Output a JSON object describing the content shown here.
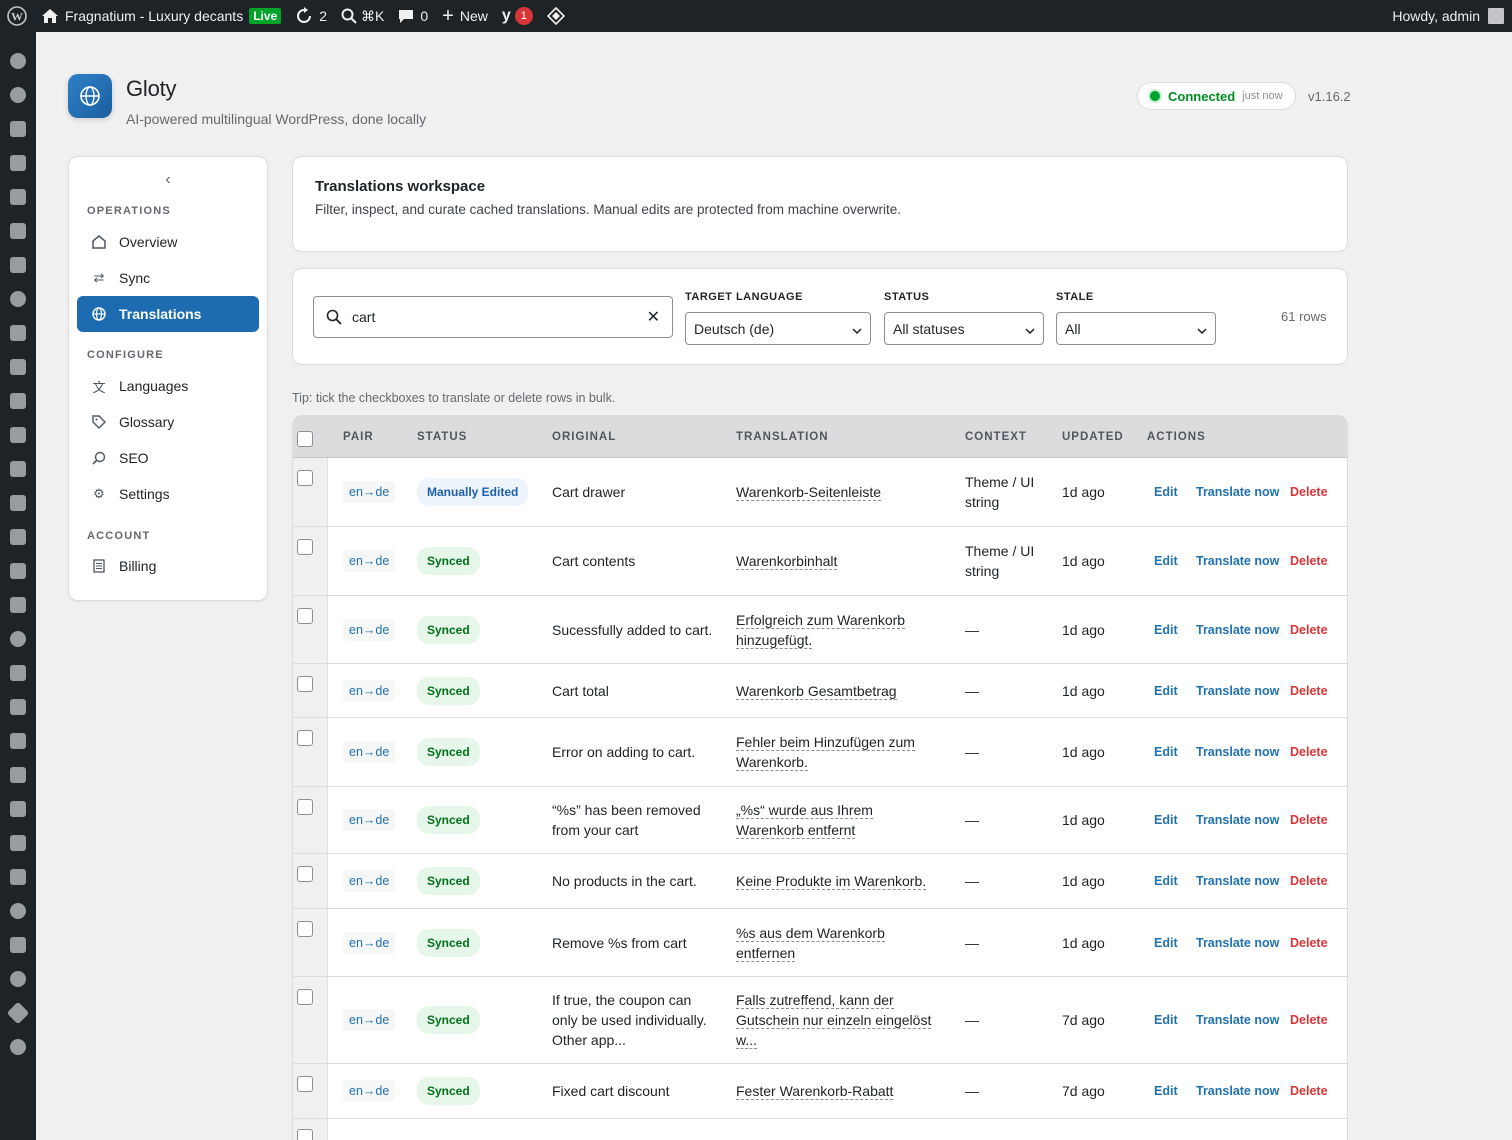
{
  "adminbar": {
    "site_name": "Fragnatium - Luxury decants",
    "live_label": "Live",
    "updates_count": "2",
    "search_shortcut": "⌘K",
    "comments_count": "0",
    "new_label": "New",
    "yoast_count": "1",
    "greeting": "Howdy, admin"
  },
  "header": {
    "title": "Gloty",
    "subtitle": "AI-powered multilingual WordPress, done locally",
    "connection_status": "Connected",
    "connection_time": "just now",
    "version": "v1.16.2"
  },
  "sidebar": {
    "sections": [
      {
        "heading": "OPERATIONS",
        "items": [
          {
            "label": "Overview",
            "icon": "home-icon"
          },
          {
            "label": "Sync",
            "icon": "sync-icon"
          },
          {
            "label": "Translations",
            "icon": "globe-icon",
            "active": true
          }
        ]
      },
      {
        "heading": "CONFIGURE",
        "items": [
          {
            "label": "Languages",
            "icon": "translate-icon"
          },
          {
            "label": "Glossary",
            "icon": "tag-icon"
          },
          {
            "label": "SEO",
            "icon": "search-icon"
          },
          {
            "label": "Settings",
            "icon": "gear-icon"
          }
        ]
      },
      {
        "heading": "ACCOUNT",
        "items": [
          {
            "label": "Billing",
            "icon": "receipt-icon"
          }
        ]
      }
    ]
  },
  "workspace": {
    "title": "Translations workspace",
    "description": "Filter, inspect, and curate cached translations. Manual edits are protected from machine overwrite."
  },
  "filters": {
    "search_value": "cart",
    "target_language_label": "TARGET LANGUAGE",
    "target_language_value": "Deutsch (de)",
    "status_label": "STATUS",
    "status_value": "All statuses",
    "stale_label": "STALE",
    "stale_value": "All",
    "row_count": "61 rows"
  },
  "tip": "Tip: tick the checkboxes to translate or delete rows in bulk.",
  "table": {
    "columns": [
      "PAIR",
      "STATUS",
      "ORIGINAL",
      "TRANSLATION",
      "CONTEXT",
      "UPDATED",
      "ACTIONS"
    ],
    "actions": {
      "edit": "Edit",
      "translate": "Translate now",
      "delete": "Delete"
    },
    "rows": [
      {
        "pair": "en→de",
        "status": "Manually Edited",
        "original": "Cart drawer",
        "translation": "Warenkorb-Seitenleiste",
        "context": "Theme / UI string",
        "updated": "1d ago"
      },
      {
        "pair": "en→de",
        "status": "Synced",
        "original": "Cart contents",
        "translation": "Warenkorbinhalt",
        "context": "Theme / UI string",
        "updated": "1d ago"
      },
      {
        "pair": "en→de",
        "status": "Synced",
        "original": "Sucessfully added to cart.",
        "translation": "Erfolgreich zum Warenkorb hinzugefügt.",
        "context": "—",
        "updated": "1d ago"
      },
      {
        "pair": "en→de",
        "status": "Synced",
        "original": "Cart total",
        "translation": "Warenkorb Gesamtbetrag",
        "context": "—",
        "updated": "1d ago"
      },
      {
        "pair": "en→de",
        "status": "Synced",
        "original": "Error on adding to cart.",
        "translation": "Fehler beim Hinzufügen zum Warenkorb.",
        "context": "—",
        "updated": "1d ago"
      },
      {
        "pair": "en→de",
        "status": "Synced",
        "original": "“%s” has been removed from your cart",
        "translation": "„%s“ wurde aus Ihrem Warenkorb entfernt",
        "context": "—",
        "updated": "1d ago"
      },
      {
        "pair": "en→de",
        "status": "Synced",
        "original": "No products in the cart.",
        "translation": "Keine Produkte im Warenkorb.",
        "context": "—",
        "updated": "1d ago"
      },
      {
        "pair": "en→de",
        "status": "Synced",
        "original": "Remove %s from cart",
        "translation": "%s aus dem Warenkorb entfernen",
        "context": "—",
        "updated": "1d ago"
      },
      {
        "pair": "en→de",
        "status": "Synced",
        "original": "If true, the coupon can only be used individually. Other app...",
        "translation": "Falls zutreffend, kann der Gutschein nur einzeln eingelöst w...",
        "context": "—",
        "updated": "7d ago"
      },
      {
        "pair": "en→de",
        "status": "Synced",
        "original": "Fixed cart discount",
        "translation": "Fester Warenkorb-Rabatt",
        "context": "—",
        "updated": "7d ago"
      }
    ]
  },
  "colors": {
    "accent": "#1d6cb1",
    "adminbar_bg": "#1d2327",
    "synced_badge": "#00701b",
    "delete": "#d63638"
  }
}
